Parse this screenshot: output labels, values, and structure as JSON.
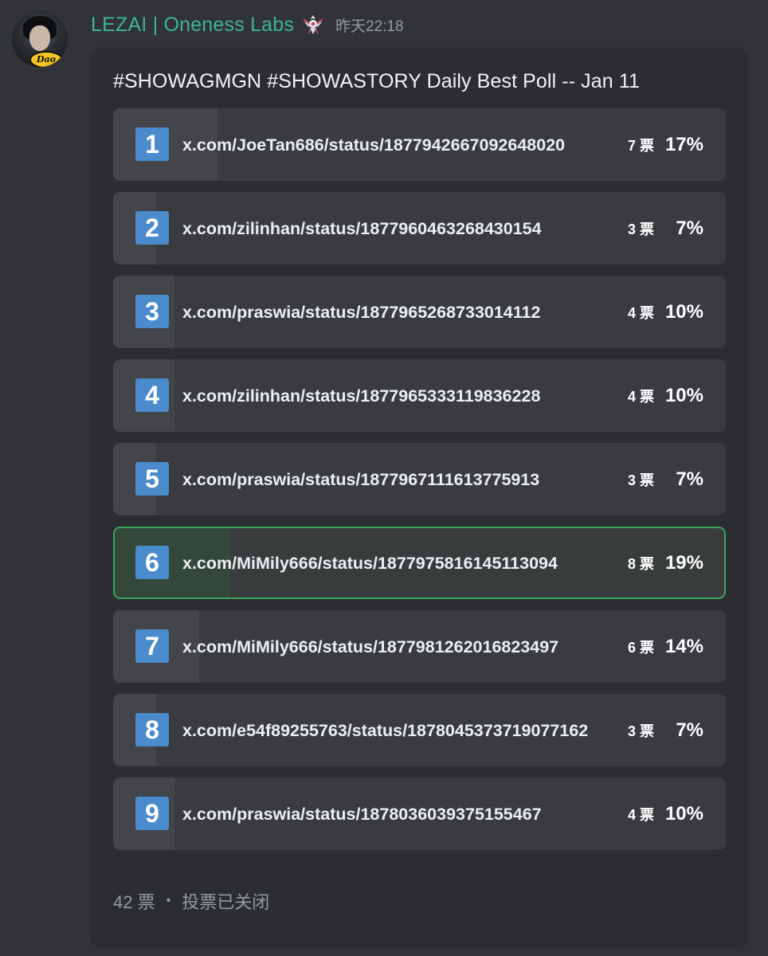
{
  "author": {
    "username": "LEZAI | Oneness Labs",
    "avatar_badge_text": "Dao",
    "role_icon": "eagle-emblem-icon",
    "timestamp": "昨天22:18",
    "name_color": "#3fb68b"
  },
  "poll": {
    "question": "#SHOWAGMGN #SHOWASTORY Daily Best Poll -- Jan 11",
    "answers": [
      {
        "number": "1",
        "label": "x.com/JoeTan686/status/1877942667092648020",
        "votes": "7 票",
        "percent": "17%",
        "fraction": 0.17,
        "winner": false
      },
      {
        "number": "2",
        "label": "x.com/zilinhan/status/1877960463268430154",
        "votes": "3 票",
        "percent": "7%",
        "fraction": 0.07,
        "winner": false
      },
      {
        "number": "3",
        "label": "x.com/praswia/status/1877965268733014112",
        "votes": "4 票",
        "percent": "10%",
        "fraction": 0.1,
        "winner": false
      },
      {
        "number": "4",
        "label": "x.com/zilinhan/status/1877965333119836228",
        "votes": "4 票",
        "percent": "10%",
        "fraction": 0.1,
        "winner": false
      },
      {
        "number": "5",
        "label": "x.com/praswia/status/1877967111613775913",
        "votes": "3 票",
        "percent": "7%",
        "fraction": 0.07,
        "winner": false
      },
      {
        "number": "6",
        "label": "x.com/MiMily666/status/1877975816145113094",
        "votes": "8 票",
        "percent": "19%",
        "fraction": 0.19,
        "winner": true
      },
      {
        "number": "7",
        "label": "x.com/MiMily666/status/1877981262016823497",
        "votes": "6 票",
        "percent": "14%",
        "fraction": 0.14,
        "winner": false
      },
      {
        "number": "8",
        "label": "x.com/e54f89255763/status/1878045373719077162",
        "votes": "3 票",
        "percent": "7%",
        "fraction": 0.07,
        "winner": false
      },
      {
        "number": "9",
        "label": "x.com/praswia/status/1878036039375155467",
        "votes": "4 票",
        "percent": "10%",
        "fraction": 0.1,
        "winner": false
      }
    ],
    "total_votes": "42 票",
    "separator": "•",
    "status": "投票已关闭",
    "winner_color": "#3ba55d",
    "number_badge_color": "#4a8ccb"
  }
}
